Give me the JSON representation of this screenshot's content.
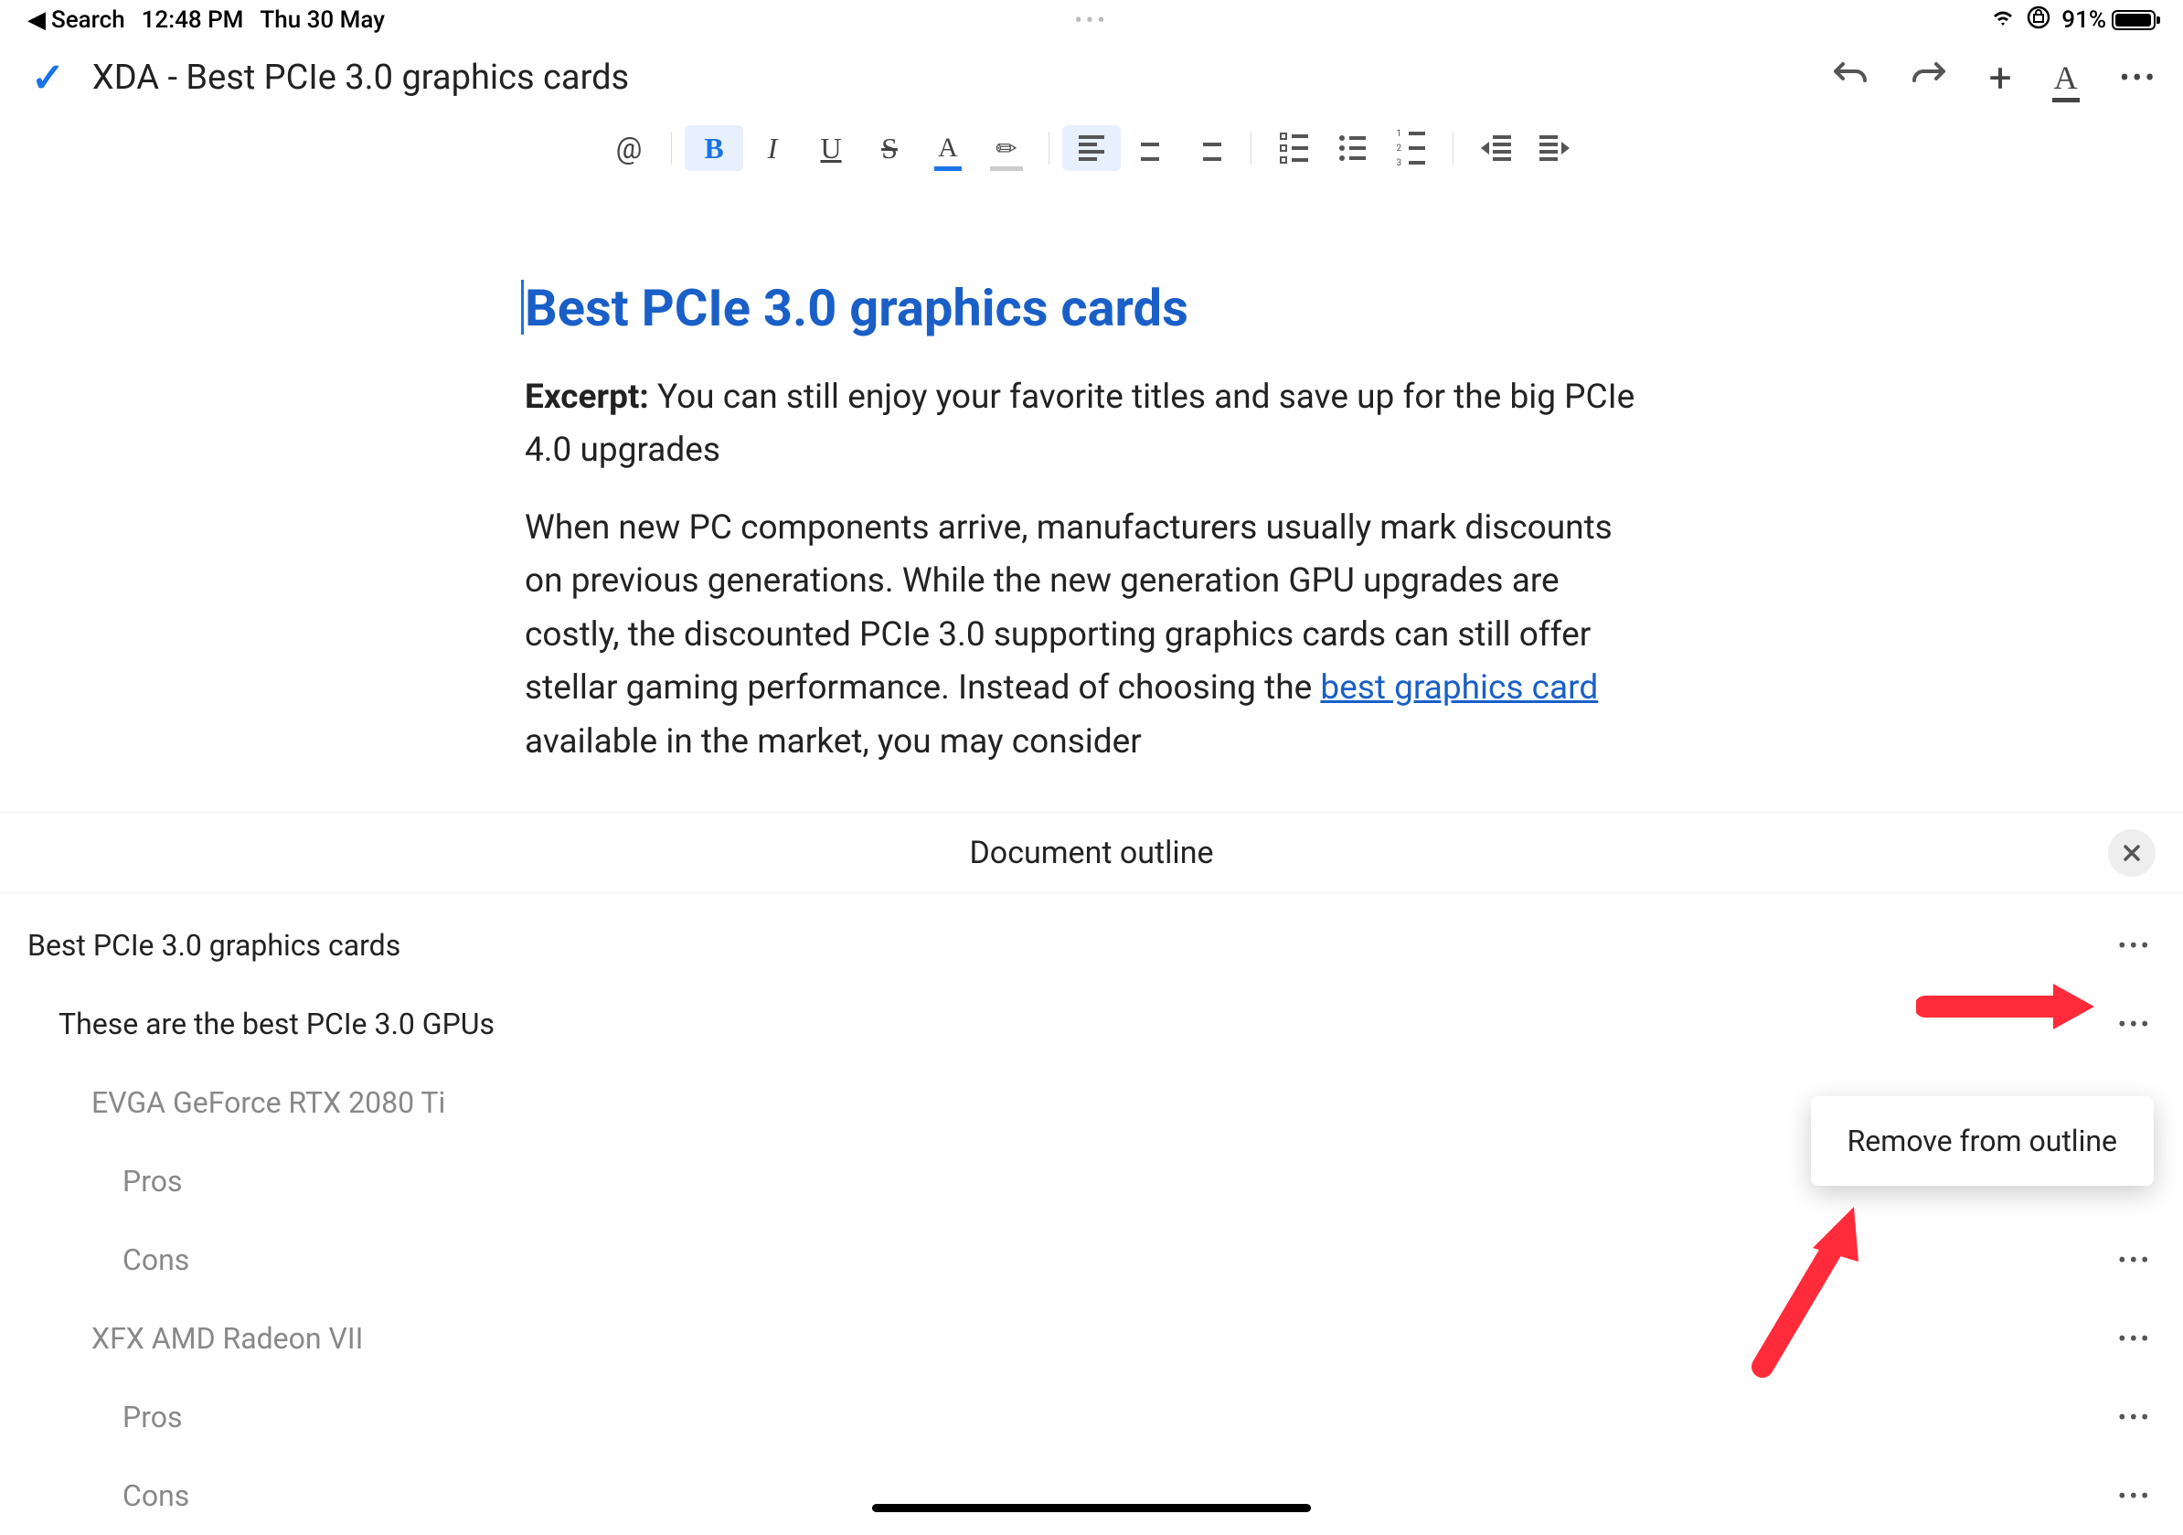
{
  "status": {
    "back_label": "Search",
    "time": "12:48 PM",
    "date": "Thu 30 May",
    "battery_pct": "91%"
  },
  "header": {
    "doc_title": "XDA - Best PCIe 3.0 graphics cards"
  },
  "document": {
    "h1": "Best PCIe 3.0 graphics cards",
    "excerpt_label": "Excerpt:",
    "excerpt_text": " You can still enjoy your favorite titles and save up for the big PCIe 4.0 upgrades",
    "para_pre": "When new PC components arrive, manufacturers usually mark discounts on previous generations. While the new generation GPU upgrades are costly, the discounted PCIe 3.0 supporting graphics cards can still offer stellar gaming performance. Instead of choosing the ",
    "para_link": "best graphics card",
    "para_post": " available in the market, you may consider"
  },
  "outline": {
    "title": "Document outline",
    "items": [
      {
        "label": "Best PCIe 3.0 graphics cards",
        "level": 0
      },
      {
        "label": "These are the best PCIe 3.0 GPUs",
        "level": 1
      },
      {
        "label": "EVGA GeForce RTX 2080 Ti",
        "level": 2
      },
      {
        "label": "Pros",
        "level": 3
      },
      {
        "label": "Cons",
        "level": 3
      },
      {
        "label": "XFX AMD Radeon VII",
        "level": 2
      },
      {
        "label": "Pros",
        "level": 3
      },
      {
        "label": "Cons",
        "level": 3
      }
    ]
  },
  "popover": {
    "label": "Remove from outline"
  }
}
